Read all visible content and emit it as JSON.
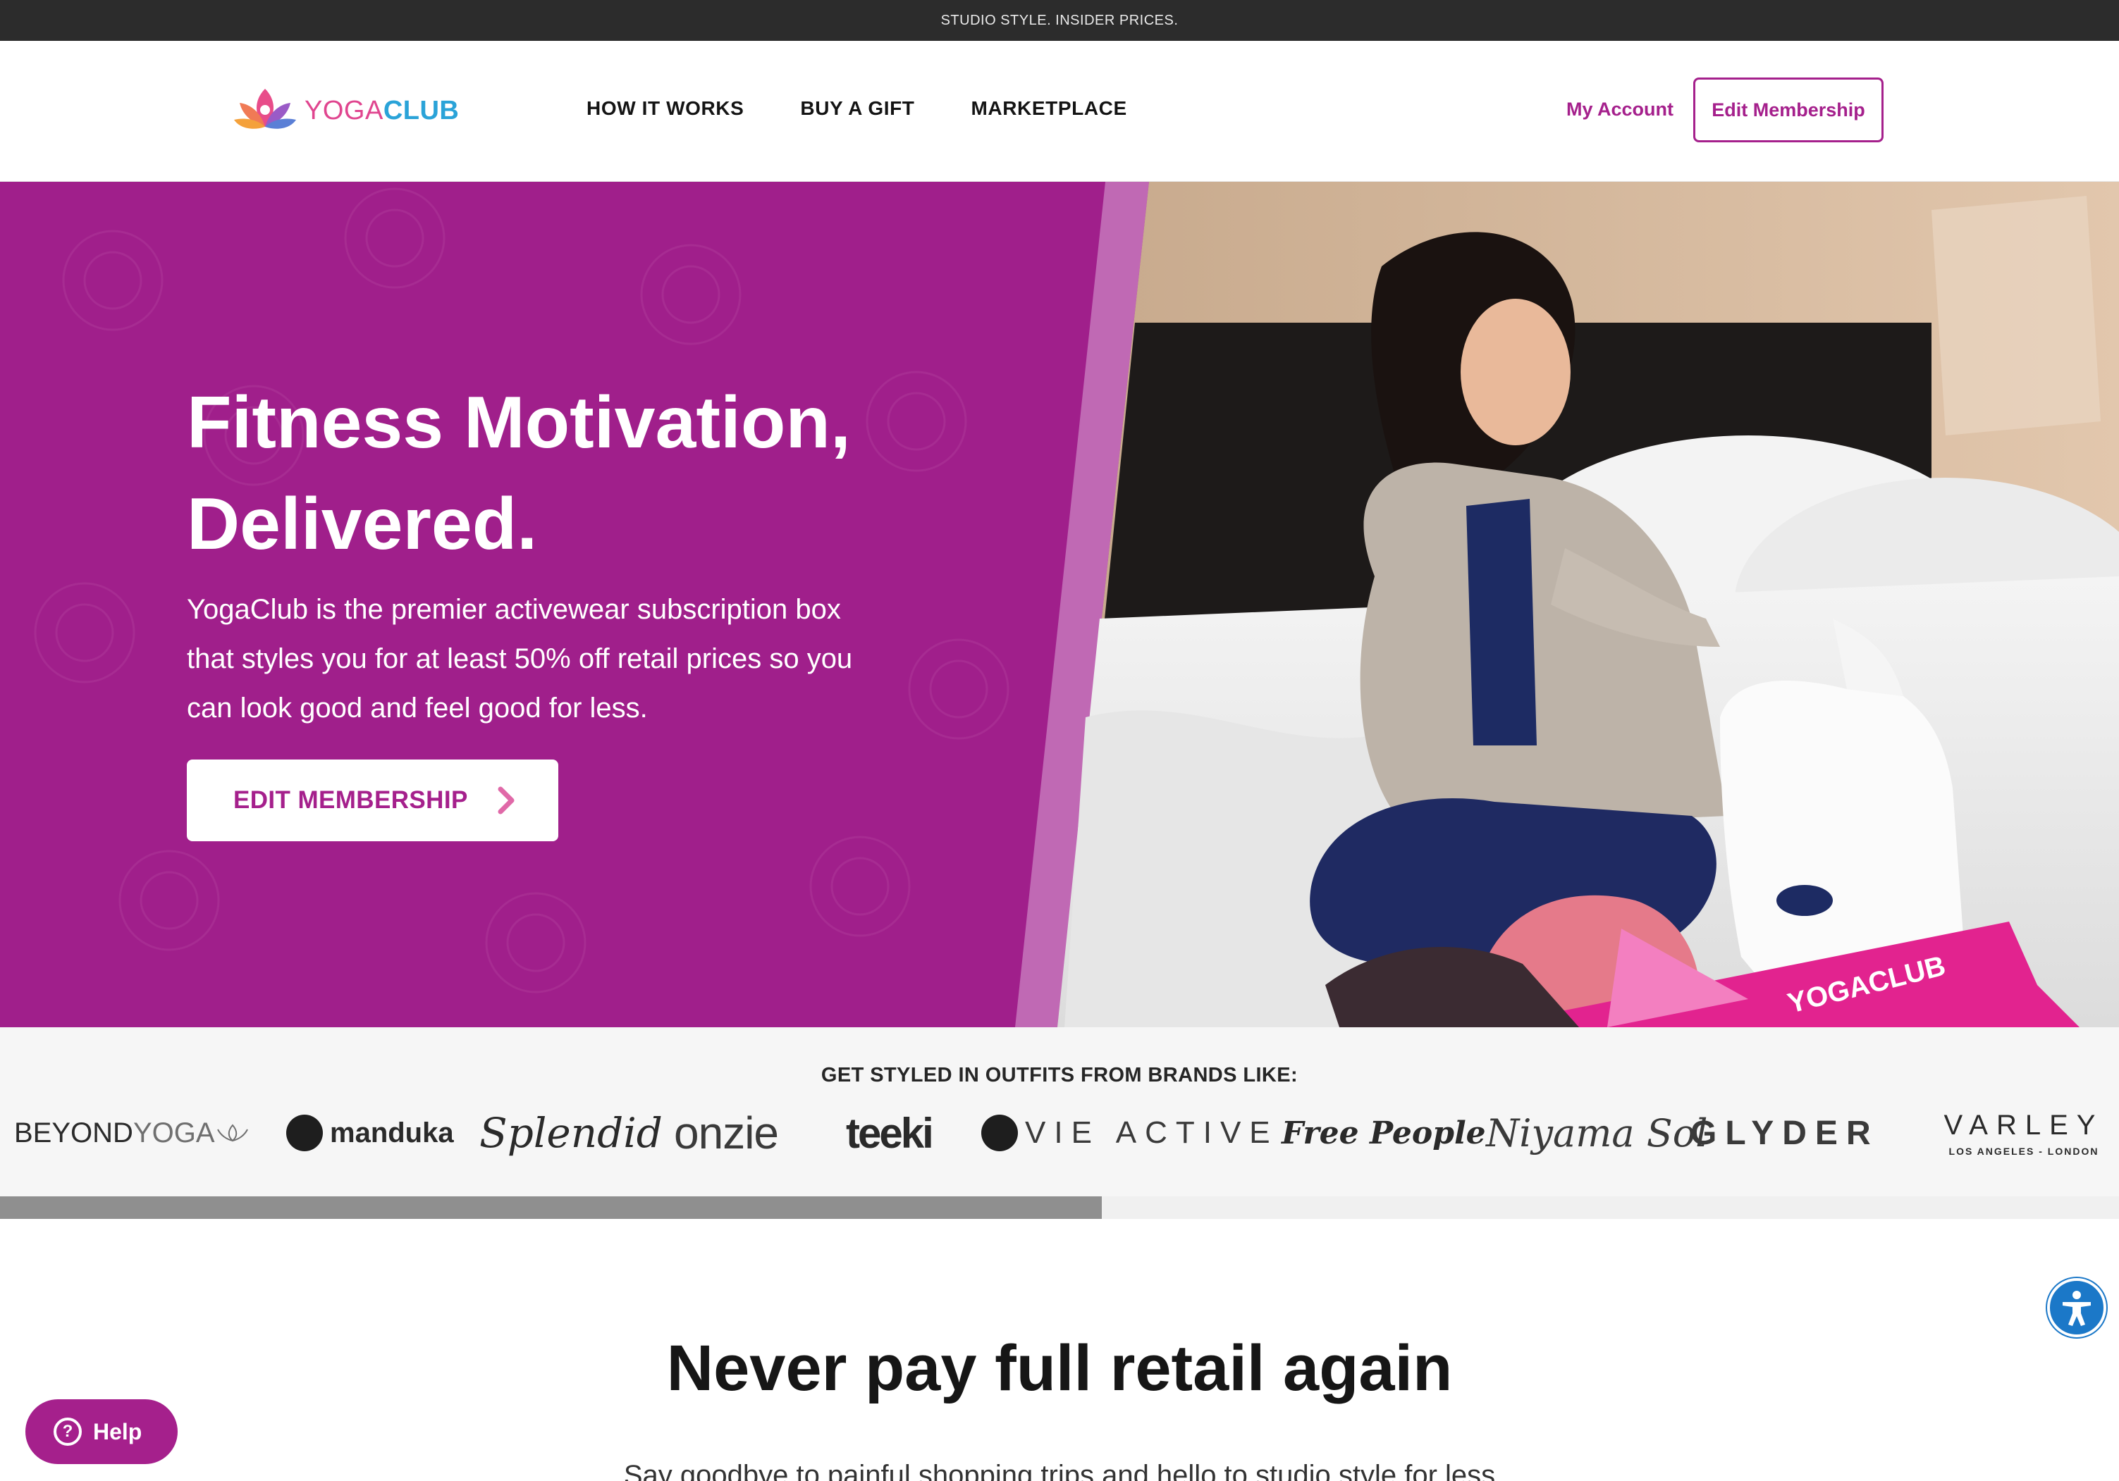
{
  "promo": {
    "text": "STUDIO STYLE. INSIDER PRICES."
  },
  "header": {
    "logo_yoga": "YOGA",
    "logo_club": "CLUB",
    "nav": [
      "HOW IT WORKS",
      "BUY A GIFT",
      "MARKETPLACE"
    ],
    "my_account": "My Account",
    "edit_membership": "Edit Membership"
  },
  "hero": {
    "title_line1": "Fitness Motivation,",
    "title_line2": "Delivered.",
    "description": "YogaClub is the premier activewear subscription box that styles you for at least 50% off retail prices so you can look good and feel good for less.",
    "cta": "EDIT MEMBERSHIP"
  },
  "brands": {
    "heading": "GET STYLED IN OUTFITS FROM BRANDS LIKE:",
    "items": {
      "beyond_a": "BEYOND",
      "beyond_b": "YOGA",
      "manduka": "manduka",
      "splendid": "Splendid",
      "onzie": "onzie",
      "teeki": "teeki",
      "vie": "VIE ACTIVE",
      "free_people": "Free People",
      "niyama": "Niyama Sol",
      "glyder": "GLYDER",
      "varley": "VARLEY",
      "varley_sub": "LOS ANGELES - LONDON"
    },
    "scroll_progress": 0.52
  },
  "section": {
    "title": "Never pay full retail again",
    "subtitle": "Say goodbye to painful shopping trips and hello to studio style for less"
  },
  "help": {
    "label": "Help"
  },
  "colors": {
    "brand_purple": "#a5208c",
    "hero_purple": "#a01f8b",
    "promo_bar": "#2c2c2c",
    "accessibility_blue": "#1b78c8"
  },
  "icons": [
    "lotus-logo-icon",
    "chevron-right-icon",
    "question-icon",
    "accessibility-icon"
  ]
}
